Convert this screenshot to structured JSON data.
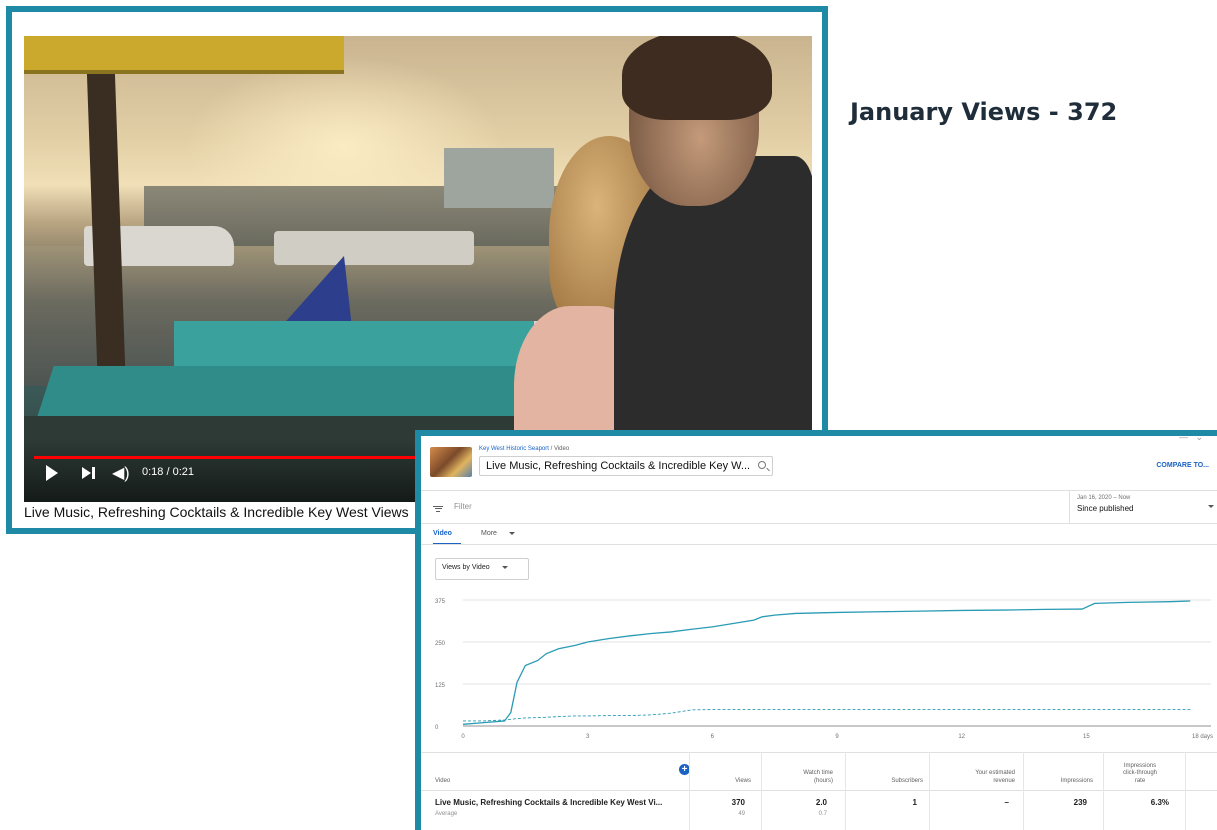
{
  "heading": "January Views - 372",
  "player": {
    "time": "0:18 / 0:21",
    "progress": 0.857,
    "title": "Live Music, Refreshing Cocktails & Incredible Key West Views"
  },
  "analytics": {
    "breadcrumb_channel": "Key West Historic Seaport",
    "breadcrumb_sep": "/",
    "breadcrumb_page": "Video",
    "video_select": "Live Music, Refreshing Cocktails & Incredible Key W...",
    "compare_label": "COMPARE TO...",
    "filter_placeholder": "Filter",
    "date_range_sub": "Jan 16, 2020 – Now",
    "date_range_main": "Since published",
    "tabs": [
      "Video",
      "More"
    ],
    "metric_dropdown": "Views by Video",
    "add_column": "+",
    "table": {
      "headers": [
        "Video",
        "Views",
        "Watch time\n(hours)",
        "Subscribers",
        "Your estimated\nrevenue",
        "Impressions",
        "Impressions\nclick-through\nrate"
      ],
      "row_label": "Live Music, Refreshing Cocktails & Incredible Key West Vi...",
      "row_sub": "Average",
      "values": [
        "370",
        "2.0",
        "1",
        "–",
        "239",
        "6.3%"
      ],
      "averages": [
        "49",
        "0.7"
      ]
    }
  },
  "chart_data": {
    "type": "line",
    "x": [
      0,
      0.5,
      1.0,
      1.15,
      1.3,
      1.5,
      1.8,
      2.0,
      2.3,
      2.7,
      3.0,
      3.5,
      4.0,
      4.5,
      5.0,
      5.5,
      6.0,
      6.5,
      7.0,
      7.2,
      7.5,
      8.0,
      9.0,
      10.0,
      11.0,
      12.0,
      13.0,
      14.0,
      14.9,
      15.2,
      16.0,
      17.0,
      17.5
    ],
    "series": [
      {
        "values": [
          5,
          10,
          15,
          40,
          130,
          180,
          195,
          215,
          230,
          240,
          250,
          260,
          268,
          275,
          280,
          288,
          295,
          305,
          315,
          325,
          330,
          335,
          338,
          340,
          342,
          344,
          345,
          347,
          348,
          365,
          368,
          370,
          372
        ],
        "style": "solid"
      },
      {
        "values": [
          15,
          15,
          18,
          20,
          22,
          24,
          25,
          26,
          28,
          30,
          30,
          31,
          31,
          33,
          38,
          48,
          49,
          49,
          49,
          49,
          49,
          49,
          49,
          49,
          49,
          49,
          49,
          49,
          49,
          49,
          49,
          49,
          49
        ],
        "style": "dashed"
      }
    ],
    "x_ticks": [
      0,
      3,
      6,
      9,
      12,
      15
    ],
    "x_tick_labels": [
      "0",
      "3",
      "6",
      "9",
      "12",
      "15"
    ],
    "x_end_label": "18 days",
    "y_ticks": [
      0,
      125,
      250,
      375
    ],
    "ylim": [
      0,
      375
    ],
    "xlim": [
      0,
      18
    ],
    "color": "#2a9bb5",
    "grid": true
  }
}
